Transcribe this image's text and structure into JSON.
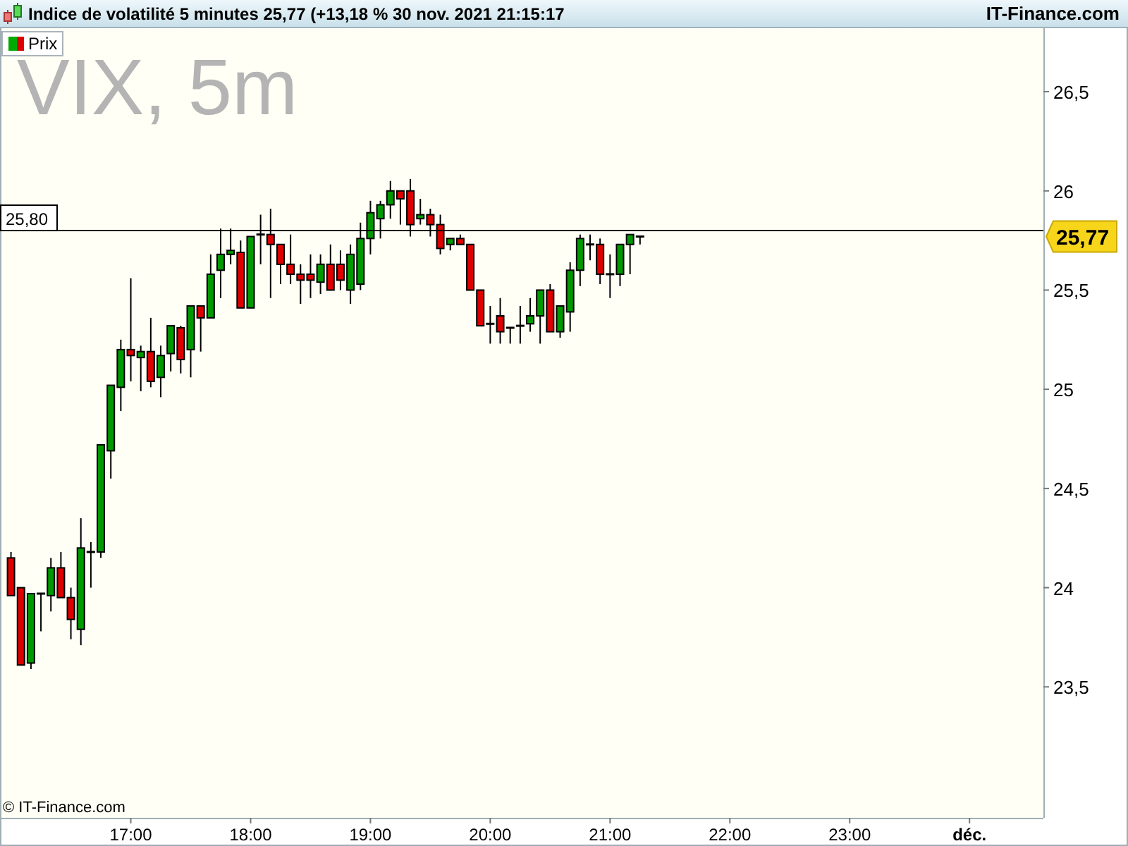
{
  "header": {
    "title": "Indice de volatilité 5 minutes 25,77 (+13,18 % 30 nov. 2021 21:15:17",
    "brand": "IT-Finance.com"
  },
  "chart": {
    "legend": "Prix",
    "symbol_label": "VIX, 5m",
    "copyright": "© IT-Finance.com",
    "chart_data": {
      "type": "candlestick",
      "ylim": [
        22.84,
        26.82
      ],
      "categories": [
        null,
        null,
        null,
        null,
        null,
        null,
        null,
        null,
        null,
        null,
        null,
        null,
        "17:00",
        null,
        null,
        null,
        null,
        null,
        null,
        null,
        null,
        null,
        null,
        null,
        "18:00",
        null,
        null,
        null,
        null,
        null,
        null,
        null,
        null,
        null,
        null,
        null,
        "19:00",
        null,
        null,
        null,
        null,
        null,
        null,
        null,
        null,
        null,
        null,
        null,
        "20:00",
        null,
        null,
        null,
        null,
        null,
        null,
        null,
        null,
        null,
        null,
        null,
        "21:00",
        null,
        null,
        null,
        null,
        null,
        null,
        null,
        null,
        null,
        null,
        null,
        "22:00",
        null,
        null,
        null,
        null,
        null,
        null,
        null,
        null,
        null,
        null,
        null,
        "23:00",
        null,
        null,
        null,
        null,
        null,
        null,
        null,
        null,
        null,
        null,
        null,
        "déc."
      ],
      "yticks": [
        {
          "value": 23.5,
          "label": "23,5"
        },
        {
          "value": 24,
          "label": "24"
        },
        {
          "value": 24.5,
          "label": "24,5"
        },
        {
          "value": 25,
          "label": "25"
        },
        {
          "value": 25.5,
          "label": "25,5"
        },
        {
          "value": 26,
          "label": "26"
        },
        {
          "value": 26.5,
          "label": "26,5"
        }
      ],
      "ohlc": [
        [
          24.15,
          24.18,
          23.96,
          23.96
        ],
        [
          24.0,
          24.0,
          23.61,
          23.61
        ],
        [
          23.62,
          23.97,
          23.59,
          23.97
        ],
        [
          23.97,
          23.97,
          23.78,
          23.97
        ],
        [
          23.96,
          24.15,
          23.88,
          24.1
        ],
        [
          24.1,
          24.18,
          23.95,
          23.95
        ],
        [
          23.95,
          24.0,
          23.74,
          23.84
        ],
        [
          23.79,
          24.35,
          23.71,
          24.2
        ],
        [
          24.18,
          24.23,
          24.0,
          24.18
        ],
        [
          24.18,
          24.72,
          24.15,
          24.72
        ],
        [
          24.69,
          25.02,
          24.55,
          25.02
        ],
        [
          25.01,
          25.25,
          24.89,
          25.2
        ],
        [
          25.2,
          25.56,
          25.04,
          25.17
        ],
        [
          25.16,
          25.22,
          24.99,
          25.19
        ],
        [
          25.19,
          25.36,
          25.01,
          25.04
        ],
        [
          25.06,
          25.22,
          24.96,
          25.17
        ],
        [
          25.18,
          25.32,
          25.09,
          25.32
        ],
        [
          25.31,
          25.32,
          25.08,
          25.15
        ],
        [
          25.2,
          25.42,
          25.06,
          25.42
        ],
        [
          25.42,
          25.42,
          25.19,
          25.36
        ],
        [
          25.36,
          25.68,
          25.36,
          25.58
        ],
        [
          25.6,
          25.81,
          25.46,
          25.68
        ],
        [
          25.68,
          25.81,
          25.63,
          25.7
        ],
        [
          25.69,
          25.75,
          25.41,
          25.41
        ],
        [
          25.41,
          25.77,
          25.41,
          25.77
        ],
        [
          25.78,
          25.88,
          25.63,
          25.78
        ],
        [
          25.78,
          25.91,
          25.46,
          25.73
        ],
        [
          25.73,
          25.73,
          25.53,
          25.63
        ],
        [
          25.63,
          25.78,
          25.53,
          25.58
        ],
        [
          25.58,
          25.63,
          25.43,
          25.55
        ],
        [
          25.58,
          25.68,
          25.46,
          25.55
        ],
        [
          25.54,
          25.68,
          25.48,
          25.63
        ],
        [
          25.63,
          25.73,
          25.5,
          25.5
        ],
        [
          25.63,
          25.7,
          25.5,
          25.55
        ],
        [
          25.5,
          25.73,
          25.43,
          25.68
        ],
        [
          25.53,
          25.84,
          25.5,
          25.76
        ],
        [
          25.76,
          25.95,
          25.68,
          25.89
        ],
        [
          25.86,
          25.95,
          25.76,
          25.93
        ],
        [
          25.93,
          26.05,
          25.86,
          26.0
        ],
        [
          26.0,
          26.0,
          25.83,
          25.96
        ],
        [
          26.0,
          26.06,
          25.77,
          25.83
        ],
        [
          25.86,
          25.96,
          25.83,
          25.88
        ],
        [
          25.88,
          25.91,
          25.77,
          25.83
        ],
        [
          25.83,
          25.88,
          25.68,
          25.71
        ],
        [
          25.73,
          25.76,
          25.7,
          25.76
        ],
        [
          25.76,
          25.78,
          25.73,
          25.73
        ],
        [
          25.73,
          25.73,
          25.5,
          25.5
        ],
        [
          25.5,
          25.5,
          25.32,
          25.32
        ],
        [
          25.33,
          25.42,
          25.23,
          25.33
        ],
        [
          25.37,
          25.46,
          25.23,
          25.29
        ],
        [
          25.31,
          25.31,
          25.23,
          25.31
        ],
        [
          25.32,
          25.42,
          25.23,
          25.32
        ],
        [
          25.33,
          25.46,
          25.29,
          25.37
        ],
        [
          25.37,
          25.5,
          25.23,
          25.5
        ],
        [
          25.5,
          25.53,
          25.29,
          25.29
        ],
        [
          25.29,
          25.42,
          25.26,
          25.42
        ],
        [
          25.39,
          25.64,
          25.29,
          25.6
        ],
        [
          25.6,
          25.78,
          25.52,
          25.76
        ],
        [
          25.73,
          25.78,
          25.65,
          25.73
        ],
        [
          25.73,
          25.76,
          25.53,
          25.58
        ],
        [
          25.58,
          25.68,
          25.46,
          25.58
        ],
        [
          25.58,
          25.73,
          25.52,
          25.73
        ],
        [
          25.73,
          25.78,
          25.58,
          25.78
        ],
        [
          25.77,
          25.77,
          25.73,
          25.77
        ],
        null,
        null,
        null,
        null,
        null,
        null,
        null,
        null,
        null,
        null,
        null,
        null,
        null,
        null,
        null,
        null,
        null,
        null,
        null,
        null,
        null,
        null,
        null,
        null,
        null,
        null,
        null,
        null,
        null,
        null,
        null,
        null,
        null
      ],
      "ref_lines": [
        {
          "axis": "y",
          "value": 25.8,
          "label": "25,80"
        }
      ],
      "annotations": [
        "25,77"
      ]
    }
  }
}
